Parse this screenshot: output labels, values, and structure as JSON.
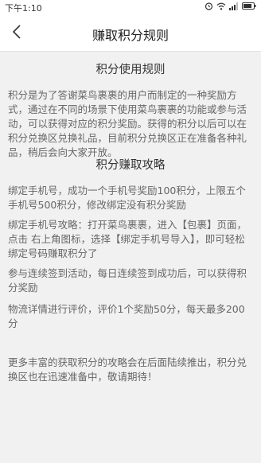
{
  "status_bar": {
    "time": "下午1:10",
    "battery": "■"
  },
  "header": {
    "title": "赚取积分规则"
  },
  "sections": [
    {
      "title": "积分使用规则",
      "paragraphs": [
        "积分是为了答谢菜鸟裹裹的用户而制定的一种奖励方式，通过在不同的场景下使用菜鸟裹裹的功能或参与活动，可以获得对应的积分奖励。获得的积分以后可以在积分兑换区兑换礼品，目前积分兑换区正在准备各种礼品，稍后会向大家开放。"
      ]
    },
    {
      "title": "积分赚取攻略",
      "paragraphs": [
        "绑定手机号，成功一个手机号奖励100积分，上限五个手机号500积分，修改绑定没有积分奖励",
        "绑定手机号攻略：打开菜鸟裹裹，进入【包裹】页面，点击 右上角图标，选择【绑定手机号导入】，即可轻松绑定号码赚取积分了",
        "参与连续签到活动，每日连续签到成功后，可以获得积分奖励",
        "物流详情进行评价，评价1个奖励50分，每天最多200分",
        "更多丰富的获取积分的攻略会在后面陆续推出，积分兑换区也在迅速准备中，敬请期待！"
      ]
    }
  ]
}
